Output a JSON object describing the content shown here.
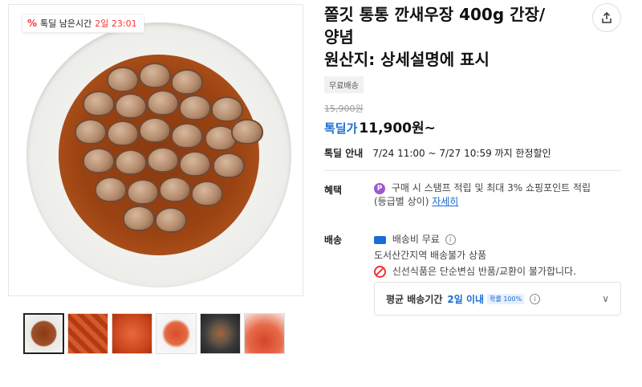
{
  "badge": {
    "icon": "percent-icon",
    "label": "톡딜 남은시간",
    "time": "2일 23:01"
  },
  "product": {
    "title_line1": "쫄깃 통통 깐새우장 400g 간장/",
    "title_line2": "양념",
    "title_line3": "원산지: 상세설명에 표시",
    "tag": "무료배송",
    "original_price": "15,900원",
    "deal_label": "톡딜가",
    "deal_price": "11,900원~"
  },
  "deal_info": {
    "label": "톡딜 안내",
    "text": "7/24 11:00 ~ 7/27 10:59 까지 한정할인"
  },
  "benefit": {
    "label": "혜택",
    "icon_text": "P",
    "text": "구매 시 스탬프 적립 및 최대 3% 쇼핑포인트 적립",
    "sub": "(등급별 상이)",
    "link": "자세히"
  },
  "shipping": {
    "label": "배송",
    "fee": "배송비 무료",
    "restriction": "도서산간지역 배송불가 상품",
    "notice": "신선식품은 단순변심 반품/교환이 불가합니다."
  },
  "delivery": {
    "label": "평균 배송기간",
    "value": "2일 이내",
    "prob": "확률 100%"
  },
  "colors": {
    "accent": "#1a6dd6",
    "sale": "#ff3333"
  }
}
